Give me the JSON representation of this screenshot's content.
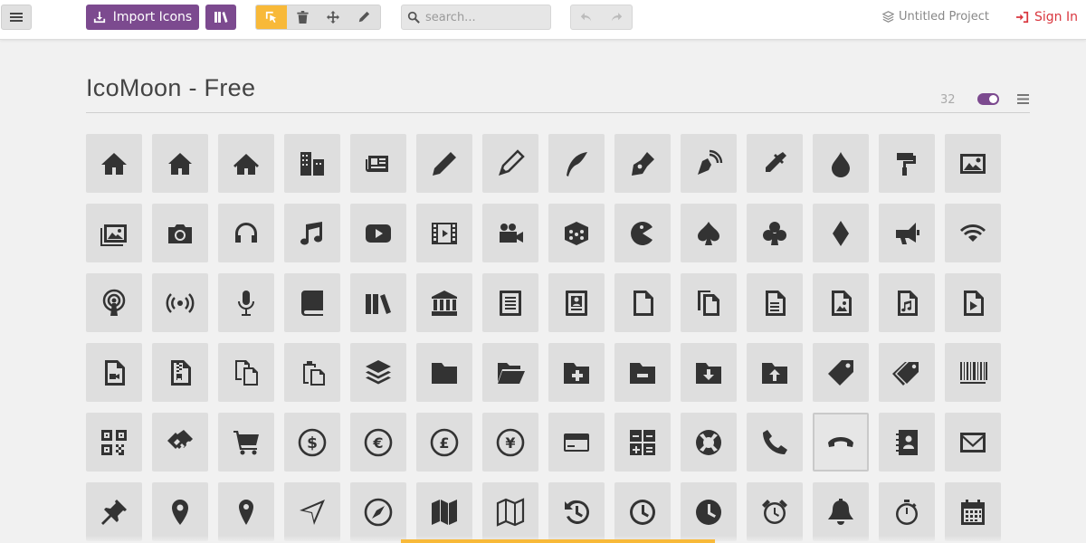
{
  "toolbar": {
    "import_label": "Import Icons",
    "search_placeholder": "search...",
    "project_name": "Untitled Project",
    "signin_label": "Sign In",
    "tools": [
      "select-tool-icon",
      "delete-tool-icon",
      "move-tool-icon",
      "edit-tool-icon"
    ],
    "active_tool": "select-tool-icon"
  },
  "icon_set": {
    "title": "IcoMoon - Free",
    "count": "32",
    "toggle_on": true
  },
  "colors": {
    "accent_purple": "#7c4a8f",
    "active_yellow": "#f8b939",
    "signin_red": "#d9363e",
    "tile": "#dedede"
  },
  "icons": [
    "home",
    "home2",
    "home3",
    "office",
    "newspaper",
    "pencil",
    "pencil2",
    "quill",
    "pen",
    "blog",
    "eyedropper",
    "droplet",
    "paint-format",
    "image",
    "images",
    "camera",
    "headphones",
    "music",
    "play",
    "film",
    "video-camera",
    "dice",
    "pacman",
    "spades",
    "clubs",
    "diamonds",
    "bullhorn",
    "connection",
    "podcast",
    "feed",
    "mic",
    "book",
    "books",
    "library",
    "file-text",
    "profile",
    "file-empty",
    "files-empty",
    "file-text2",
    "file-picture",
    "file-music",
    "file-play",
    "file-video",
    "file-zip",
    "copy",
    "paste",
    "stack",
    "folder",
    "folder-open",
    "folder-plus",
    "folder-minus",
    "folder-download",
    "folder-upload",
    "price-tag",
    "price-tags",
    "barcode",
    "qrcode",
    "ticket",
    "cart",
    "coin-dollar",
    "coin-euro",
    "coin-pound",
    "coin-yen",
    "credit-card",
    "calculator",
    "lifebuoy",
    "phone",
    "phone-hang-up",
    "address-book",
    "envelop",
    "pushpin",
    "location",
    "location2",
    "compass",
    "compass2",
    "map",
    "map2",
    "history",
    "clock",
    "clock2",
    "alarm",
    "bell",
    "stopwatch",
    "calendar"
  ],
  "hover_icon": "phone-hang-up"
}
